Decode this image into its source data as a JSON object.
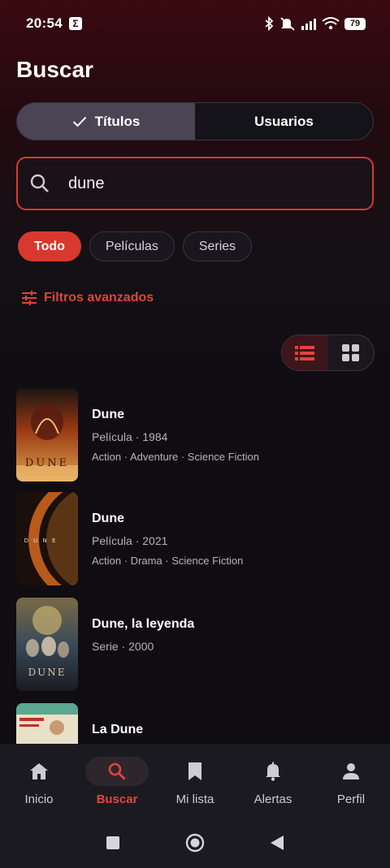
{
  "status_bar": {
    "time": "20:54",
    "notif_glyph": "Σ",
    "battery": "79"
  },
  "header": {
    "title": "Buscar"
  },
  "segments": {
    "titles": "Títulos",
    "users": "Usuarios"
  },
  "search": {
    "value": "dune",
    "placeholder": ""
  },
  "chips": [
    "Todo",
    "Películas",
    "Series"
  ],
  "advanced_filters": "Filtros avanzados",
  "view_toggle": {
    "active": "list"
  },
  "results": [
    {
      "title": "Dune",
      "meta": "Película · 1984",
      "genres": "Action · Adventure · Science Fiction"
    },
    {
      "title": "Dune",
      "meta": "Película · 2021",
      "genres": "Action · Drama · Science Fiction"
    },
    {
      "title": "Dune, la leyenda",
      "meta": "Serie · 2000",
      "genres": ""
    },
    {
      "title": "La Dune",
      "meta": "",
      "genres": ""
    }
  ],
  "posters": {
    "p1_word": "DUNE",
    "p2_word": "D U N E",
    "p3_word": "DUNE"
  },
  "bottom_nav": [
    {
      "label": "Inicio",
      "icon": "home-icon"
    },
    {
      "label": "Buscar",
      "icon": "search-icon"
    },
    {
      "label": "Mi lista",
      "icon": "bookmark-icon"
    },
    {
      "label": "Alertas",
      "icon": "bell-icon"
    },
    {
      "label": "Perfil",
      "icon": "person-icon"
    }
  ],
  "colors": {
    "accent": "#d9382e",
    "background": "#0f0d12",
    "nav_bg": "#1c1a21"
  }
}
